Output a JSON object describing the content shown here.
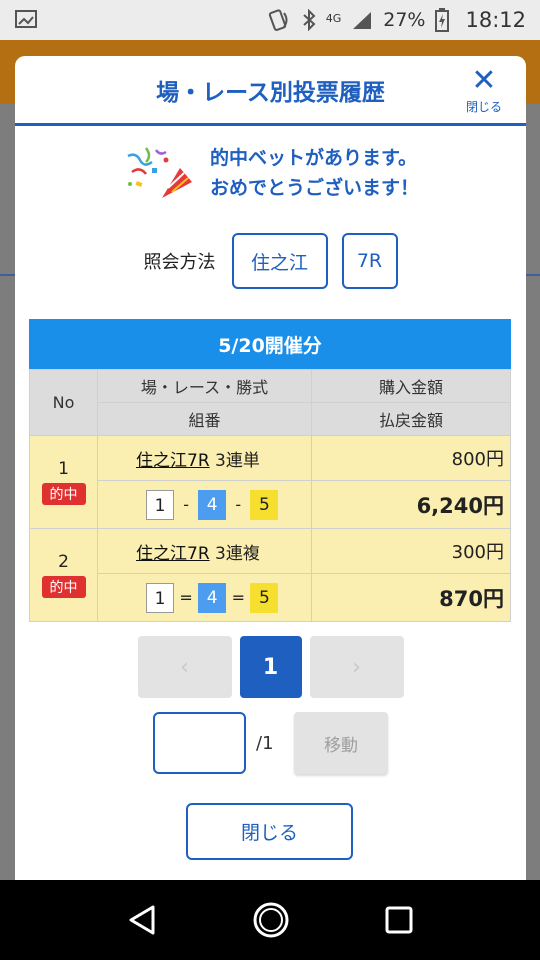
{
  "status": {
    "network": "4G",
    "battery": "27%",
    "time": "18:12"
  },
  "modal": {
    "title": "場・レース別投票履歴",
    "close_label": "閉じる",
    "congrats_line1": "的中ベットがあります。",
    "congrats_line2": "おめでとうございます！",
    "query_label": "照会方法",
    "venue": "住之江",
    "race": "7R",
    "date_header": "5/20開催分",
    "table": {
      "col_no": "No",
      "col_race": "場・レース・勝式",
      "col_combo": "組番",
      "col_purchase": "購入金額",
      "col_payout": "払戻金額",
      "rows": [
        {
          "no": "1",
          "badge": "的中",
          "race": "住之江7R",
          "bet_type": "3連単",
          "combo": [
            "1",
            "4",
            "5"
          ],
          "sep": "-",
          "purchase": "800円",
          "payout": "6,240円"
        },
        {
          "no": "2",
          "badge": "的中",
          "race": "住之江7R",
          "bet_type": "3連複",
          "combo": [
            "1",
            "4",
            "5"
          ],
          "sep": "=",
          "purchase": "300円",
          "payout": "870円"
        }
      ]
    },
    "pager": {
      "prev": "‹",
      "current": "1",
      "next": "›"
    },
    "jump": {
      "total": "/1",
      "button": "移動"
    },
    "close_button": "閉じる"
  },
  "colors": {
    "accent": "#1e5fbf",
    "date_bar": "#1a8fe9",
    "hit_badge": "#e03131",
    "row_bg": "#faeeb0"
  }
}
